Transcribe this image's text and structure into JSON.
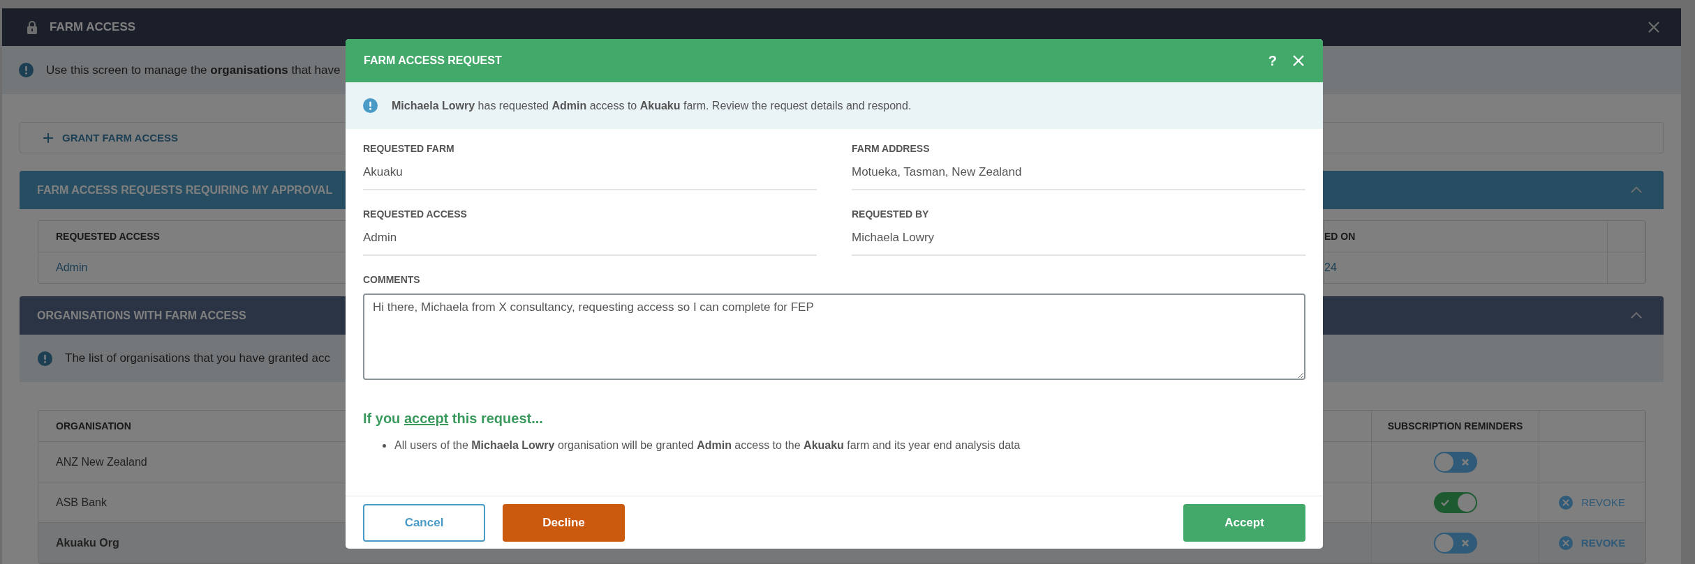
{
  "window": {
    "title": "FARM ACCESS",
    "info": "Use this screen to manage the **organisations** that have"
  },
  "grant_button": {
    "label": "GRANT FARM ACCESS"
  },
  "requests_panel": {
    "title": "FARM ACCESS REQUESTS REQUIRING MY APPROVAL",
    "expanded": true,
    "columns": [
      "REQUESTED ACCESS",
      "ED ON"
    ],
    "rows": [
      [
        "Admin",
        "24"
      ]
    ]
  },
  "organisations_panel": {
    "title": "ORGANISATIONS WITH FARM ACCESS",
    "expanded": true,
    "info": "The list of organisations that you have granted acc",
    "columns": [
      "ORGANISATION",
      "SUBSCRIPTION REMINDERS"
    ],
    "rows": [
      {
        "organisation": "ANZ New Zealand",
        "selected": false,
        "reminders_on": false
      },
      {
        "organisation": "ASB Bank",
        "selected": false,
        "reminders_on": true,
        "action": "REVOKE"
      },
      {
        "organisation": "Akuaku Org",
        "selected": true,
        "reminders_on": false,
        "action": "REVOKE"
      }
    ]
  },
  "dialog": {
    "title": "FARM ACCESS REQUEST",
    "help": "?",
    "message": "**Michaela Lowry** has requested **Admin** access to **Akuaku** farm. Review the request details and respond.",
    "fields": [
      {
        "label": "REQUESTED FARM",
        "value": "Akuaku"
      },
      {
        "label": "FARM ADDRESS",
        "value": "Motueka, Tasman, New Zealand"
      },
      {
        "label": "REQUESTED ACCESS",
        "value": "Admin"
      },
      {
        "label": "REQUESTED BY",
        "value": "Michaela Lowry"
      }
    ],
    "comments": {
      "label": "COMMENTS",
      "value": "Hi there, Michaela from X consultancy, requesting access so I can complete for FEP"
    },
    "consequence": {
      "before": "If you",
      "link": "accept",
      "after": "this request...",
      "items": [
        "All users of the **Michaela Lowry** organisation will be granted **Admin** access to the **Akuaku** farm and its year end analysis data"
      ]
    },
    "buttons": [
      {
        "label": "Cancel",
        "kind": "outline"
      },
      {
        "label": "Decline",
        "kind": "danger"
      },
      {
        "label": "Accept",
        "kind": "primary"
      }
    ]
  }
}
